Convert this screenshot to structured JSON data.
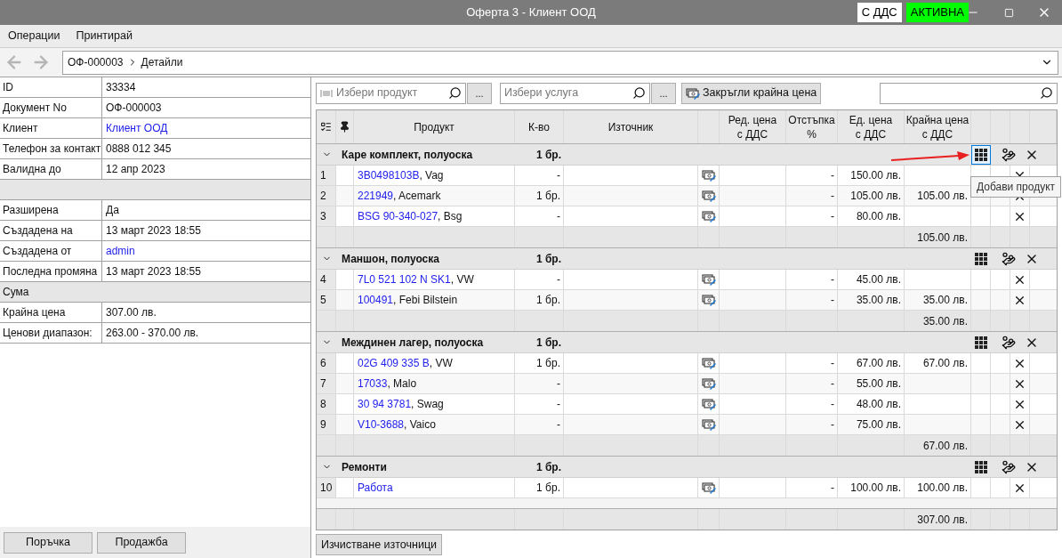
{
  "window": {
    "title": "Оферта 3 - Клиент ООД",
    "badges": [
      {
        "label": "С ДДС",
        "color": "#ffffff"
      },
      {
        "label": "АКТИВНА",
        "color": "#00ff00"
      }
    ]
  },
  "menu": [
    "Операции",
    "Принтирай"
  ],
  "breadcrumb": [
    "ОФ-000003",
    "Детайли"
  ],
  "details": [
    {
      "kind": "field",
      "label": "ID",
      "value": "33334",
      "link": false
    },
    {
      "kind": "field",
      "label": "Документ No",
      "value": "ОФ-000003",
      "link": false
    },
    {
      "kind": "field",
      "label": "Клиент",
      "value": "Клиент ООД",
      "link": true
    },
    {
      "kind": "field",
      "label": "Телефон за контакт",
      "value": "0888 012 345",
      "link": false
    },
    {
      "kind": "field",
      "label": "Валидна до",
      "value": "12 апр 2023",
      "link": false
    },
    {
      "kind": "section"
    },
    {
      "kind": "field",
      "label": "Разширена",
      "value": "Да",
      "link": false
    },
    {
      "kind": "field",
      "label": "Създадена на",
      "value": "13 март 2023 18:55",
      "link": false
    },
    {
      "kind": "field",
      "label": "Създадена от",
      "value": "admin",
      "link": true
    },
    {
      "kind": "field",
      "label": "Последна промяна",
      "value": "13 март 2023 18:55",
      "link": false
    },
    {
      "kind": "section",
      "label": "Сума"
    },
    {
      "kind": "field",
      "label": "Крайна цена",
      "value": "307.00 лв.",
      "link": false
    },
    {
      "kind": "field",
      "label": "Ценови диапазон:",
      "value": "263.00 - 370.00 лв.",
      "link": false
    }
  ],
  "left_buttons": [
    "Поръчка",
    "Продажба"
  ],
  "toolbar": {
    "product_search": {
      "placeholder": "Избери продукт",
      "more": "..."
    },
    "service_search": {
      "placeholder": "Избери услуга",
      "more": "..."
    },
    "round_button": "Закръгли крайна цена"
  },
  "table": {
    "columns": [
      "Продукт",
      "К-во",
      "Източник",
      "Ред. цена\nс ДДС",
      "Отстъпка\n%",
      "Ед. цена\nс ДДС",
      "Крайна цена\nс ДДС"
    ],
    "groups": [
      {
        "name": "Каре комплект, полуоска",
        "qty": "1 бр.",
        "expanded": true,
        "add_focused": true,
        "items": [
          {
            "number": "1",
            "code": "3B0498103B",
            "brand": ", Vag",
            "qty": "-",
            "discount": "-",
            "unit_price": "150.00 лв."
          },
          {
            "number": "2",
            "code": "221949",
            "brand": ", Acemark",
            "qty": "1 бр.",
            "discount": "-",
            "unit_price": "105.00 лв.",
            "final_price": "105.00 лв."
          },
          {
            "number": "3",
            "code": "BSG 90-340-027",
            "brand": ", Bsg",
            "qty": "-",
            "discount": "-",
            "unit_price": "80.00 лв."
          }
        ],
        "subtotal": "105.00 лв."
      },
      {
        "name": "Маншон, полуоска",
        "qty": "1 бр.",
        "expanded": true,
        "add_focused": false,
        "items": [
          {
            "number": "4",
            "code": "7L0 521 102 N SK1",
            "brand": ", VW",
            "qty": "-",
            "discount": "-",
            "unit_price": "45.00 лв."
          },
          {
            "number": "5",
            "code": "100491",
            "brand": ", Febi Bilstein",
            "qty": "1 бр.",
            "discount": "-",
            "unit_price": "35.00 лв.",
            "final_price": "35.00 лв."
          }
        ],
        "subtotal": "35.00 лв."
      },
      {
        "name": "Междинен лагер, полуоска",
        "qty": "1 бр.",
        "expanded": true,
        "add_focused": false,
        "items": [
          {
            "number": "6",
            "code": "02G 409 335 B",
            "brand": ", VW",
            "qty": "1 бр.",
            "discount": "-",
            "unit_price": "67.00 лв.",
            "final_price": "67.00 лв."
          },
          {
            "number": "7",
            "code": "17033",
            "brand": ", Malo",
            "qty": "-",
            "discount": "-",
            "unit_price": "55.00 лв."
          },
          {
            "number": "8",
            "code": "30 94 3781",
            "brand": ", Swag",
            "qty": "-",
            "discount": "-",
            "unit_price": "48.00 лв."
          },
          {
            "number": "9",
            "code": "V10-3688",
            "brand": ", Vaico",
            "qty": "-",
            "discount": "-",
            "unit_price": "75.00 лв."
          }
        ],
        "subtotal": "67.00 лв."
      },
      {
        "name": "Ремонти",
        "qty": "1 бр.",
        "expanded": true,
        "add_focused": false,
        "items": [
          {
            "number": "10",
            "code": "Работа",
            "qty": "1 бр.",
            "discount": "-",
            "unit_price": "100.00 лв.",
            "final_price": "100.00 лв."
          }
        ]
      }
    ],
    "grand_total": "307.00 лв.",
    "tooltip": "Добави продукт"
  },
  "bottom_button": "Изчистване източници"
}
